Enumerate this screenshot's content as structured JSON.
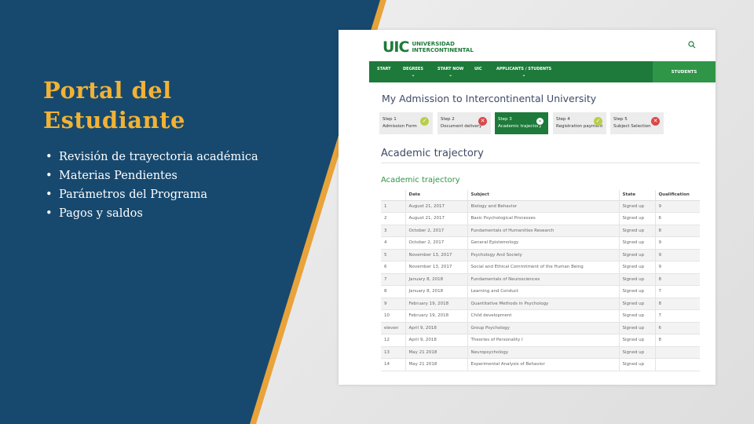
{
  "slide": {
    "title_line1": "Portal del",
    "title_line2": "Estudiante",
    "bullets": [
      "Revisión de trayectoria académica",
      "Materias Pendientes",
      "Parámetros del Programa",
      "Pagos y saldos"
    ]
  },
  "portal": {
    "brand": {
      "mark": "UIC",
      "line1": "UNIVERSIDAD",
      "line2": "INTERCONTINENTAL"
    },
    "nav": [
      {
        "label": "START",
        "chevron": ""
      },
      {
        "label": "DEGREES",
        "chevron": "⌄"
      },
      {
        "label": "START NOW",
        "chevron": "⌄"
      },
      {
        "label": "UIC",
        "chevron": ""
      },
      {
        "label": "APPLICANTS / STUDENTS",
        "chevron": "⌄"
      }
    ],
    "students_button": "STUDENTS",
    "heading": "My Admission to Intercontinental University",
    "steps": [
      {
        "step": "Step 1",
        "name": "Admission Form",
        "status": "✓"
      },
      {
        "step": "Step 2",
        "name": "Document delivery",
        "status": "✕"
      },
      {
        "step": "Step 3",
        "name": "Academic trajectory",
        "status": "–"
      },
      {
        "step": "Step 4",
        "name": "Registration payment",
        "status": "✓"
      },
      {
        "step": "Step 5",
        "name": "Subject Selection",
        "status": "✕"
      }
    ],
    "section_title": "Academic trajectory",
    "sub_title": "Academic trajectory",
    "table": {
      "headers": [
        "",
        "Date",
        "Subject",
        "State",
        "Qualification"
      ],
      "rows": [
        [
          "1",
          "August 21, 2017",
          "Biology and Behavior",
          "Signed up",
          "9"
        ],
        [
          "2",
          "August 21, 2017",
          "Basic Psychological Processes",
          "Signed up",
          "6"
        ],
        [
          "3",
          "October 2, 2017",
          "Fundamentals of Humanities Research",
          "Signed up",
          "8"
        ],
        [
          "4",
          "October 2, 2017",
          "General Epistemology",
          "Signed up",
          "9"
        ],
        [
          "5",
          "November 13, 2017",
          "Psychology And Society",
          "Signed up",
          "9"
        ],
        [
          "6",
          "November 13, 2017",
          "Social and Ethical Commitment of the Human Being",
          "Signed up",
          "9"
        ],
        [
          "7",
          "January 8, 2018",
          "Fundamentals of Neurosciences",
          "Signed up",
          "8"
        ],
        [
          "8",
          "January 8, 2018",
          "Learning and Conduct",
          "Signed up",
          "7"
        ],
        [
          "9",
          "February 19, 2018",
          "Quantitative Methods in Psychology",
          "Signed up",
          "8"
        ],
        [
          "10",
          "February 19, 2018",
          "Child development",
          "Signed up",
          "7"
        ],
        [
          "eleven",
          "April 9, 2018",
          "Group Psychology",
          "Signed up",
          "6"
        ],
        [
          "12",
          "April 9, 2018",
          "Theories of Personality I",
          "Signed up",
          "8"
        ],
        [
          "13",
          "May 21 2018",
          "Neuropsychology",
          "Signed up",
          ""
        ],
        [
          "14",
          "May 21 2018",
          "Experimental Analysis of Behavior",
          "Signed up",
          ""
        ]
      ]
    }
  }
}
